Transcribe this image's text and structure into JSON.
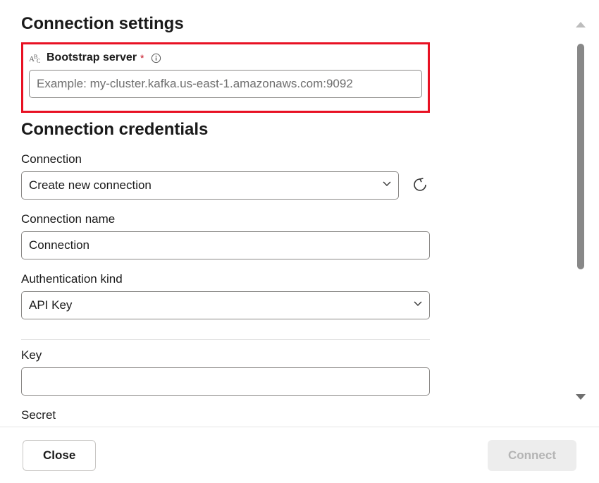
{
  "sections": {
    "connection_settings_title": "Connection settings",
    "connection_credentials_title": "Connection credentials"
  },
  "bootstrap": {
    "label": "Bootstrap server",
    "placeholder": "Example: my-cluster.kafka.us-east-1.amazonaws.com:9092",
    "value": ""
  },
  "connection": {
    "label": "Connection",
    "selected": "Create new connection"
  },
  "connection_name": {
    "label": "Connection name",
    "value": "Connection"
  },
  "auth_kind": {
    "label": "Authentication kind",
    "selected": "API Key"
  },
  "key": {
    "label": "Key",
    "value": ""
  },
  "secret": {
    "label": "Secret"
  },
  "footer": {
    "close": "Close",
    "connect": "Connect"
  }
}
